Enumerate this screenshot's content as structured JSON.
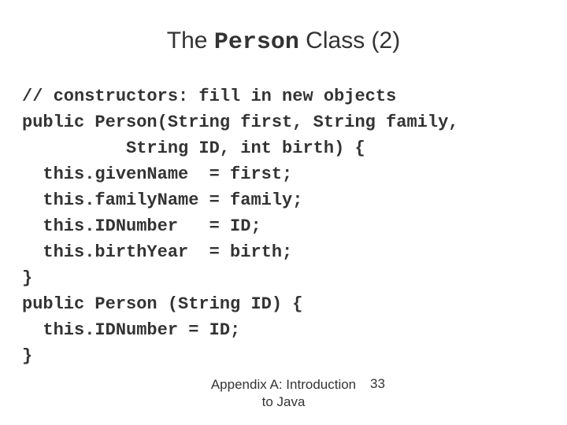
{
  "title": {
    "prefix": "The ",
    "mono": "Person",
    "suffix": " Class (2)"
  },
  "code": "// constructors: fill in new objects\npublic Person(String first, String family,\n          String ID, int birth) {\n  this.givenName  = first;\n  this.familyName = family;\n  this.IDNumber   = ID;\n  this.birthYear  = birth;\n}\npublic Person (String ID) {\n  this.IDNumber = ID;\n}",
  "footer": {
    "text": "Appendix A: Introduction to Java",
    "page": "33"
  }
}
